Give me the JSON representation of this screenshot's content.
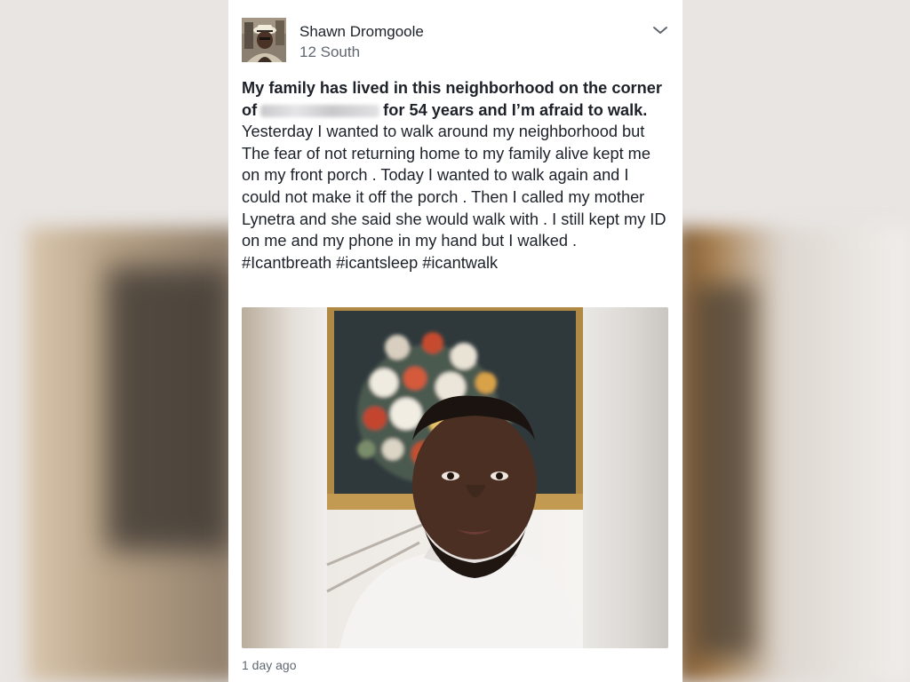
{
  "post": {
    "author_name": "Shawn Dromgoole",
    "location": "12 South",
    "text_bold_1": "My family has lived in this neighborhood on the corner of",
    "text_bold_2": "for 54 years and I’m afraid to walk.",
    "text_body": " Yesterday I wanted to walk around my neighborhood  but The fear of not returning home to my family alive kept me on my front porch . Today I wanted to walk again and I could not make it off the porch . Then I called my mother Lynetra  and she said she would walk with . I still kept my ID on me and my phone in my hand but I walked .  #Icantbreath #icantsleep  #icantwalk",
    "timestamp": "1 day ago"
  },
  "icons": {
    "menu": "chevron-down-icon"
  },
  "colors": {
    "card_background": "#ffffff",
    "text_primary": "#1d2129",
    "text_secondary": "#616770"
  }
}
